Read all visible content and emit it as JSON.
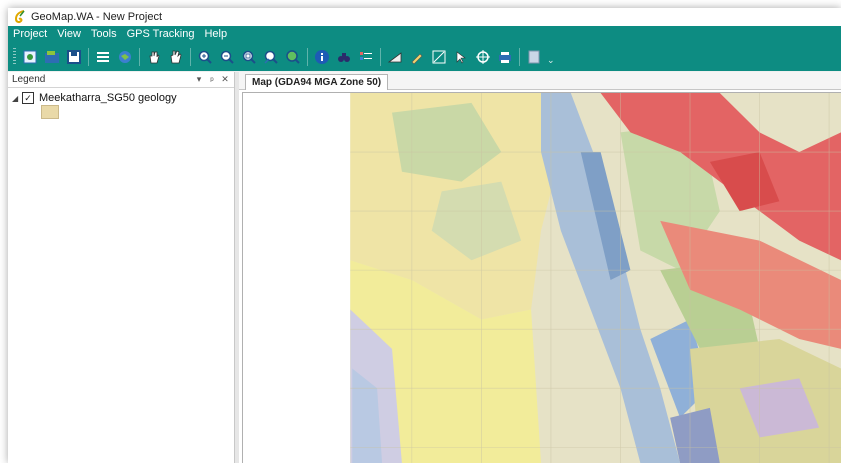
{
  "window": {
    "title": "GeoMap.WA - New Project"
  },
  "menu": [
    "Project",
    "View",
    "Tools",
    "GPS Tracking",
    "Help"
  ],
  "toolbar": {
    "groups": [
      [
        "new-project-icon",
        "open-project-icon",
        "save-icon"
      ],
      [
        "layer-properties-icon",
        "add-layer-icon"
      ],
      [
        "pan-icon",
        "pan-hand-icon"
      ],
      [
        "zoom-in-icon",
        "zoom-out-icon",
        "zoom-box-icon",
        "zoom-extent-icon",
        "zoom-full-icon"
      ],
      [
        "identify-icon",
        "find-icon",
        "legend-table-icon"
      ],
      [
        "measure-icon",
        "draw-tool-icon",
        "scale-icon",
        "coordinate-icon",
        "gps-icon",
        "print-icon"
      ],
      [
        "export-icon"
      ]
    ],
    "overflow": "⌄"
  },
  "legend": {
    "title": "Legend",
    "controls": [
      "▾",
      "ᵖ",
      "✕"
    ],
    "expander": "◢",
    "check": "✓",
    "layer_label": "Meekatharra_SG50 geology"
  },
  "map_tab": {
    "label": "Map (GDA94 MGA Zone 50)"
  },
  "colors": {
    "teal": "#0d8c82",
    "map_base": "#e6e2c6",
    "red_unit": "#e36464",
    "yellow_unit": "#f0e68a",
    "blue_unit": "#a9bfd8",
    "green_unit": "#c7d9a8"
  }
}
